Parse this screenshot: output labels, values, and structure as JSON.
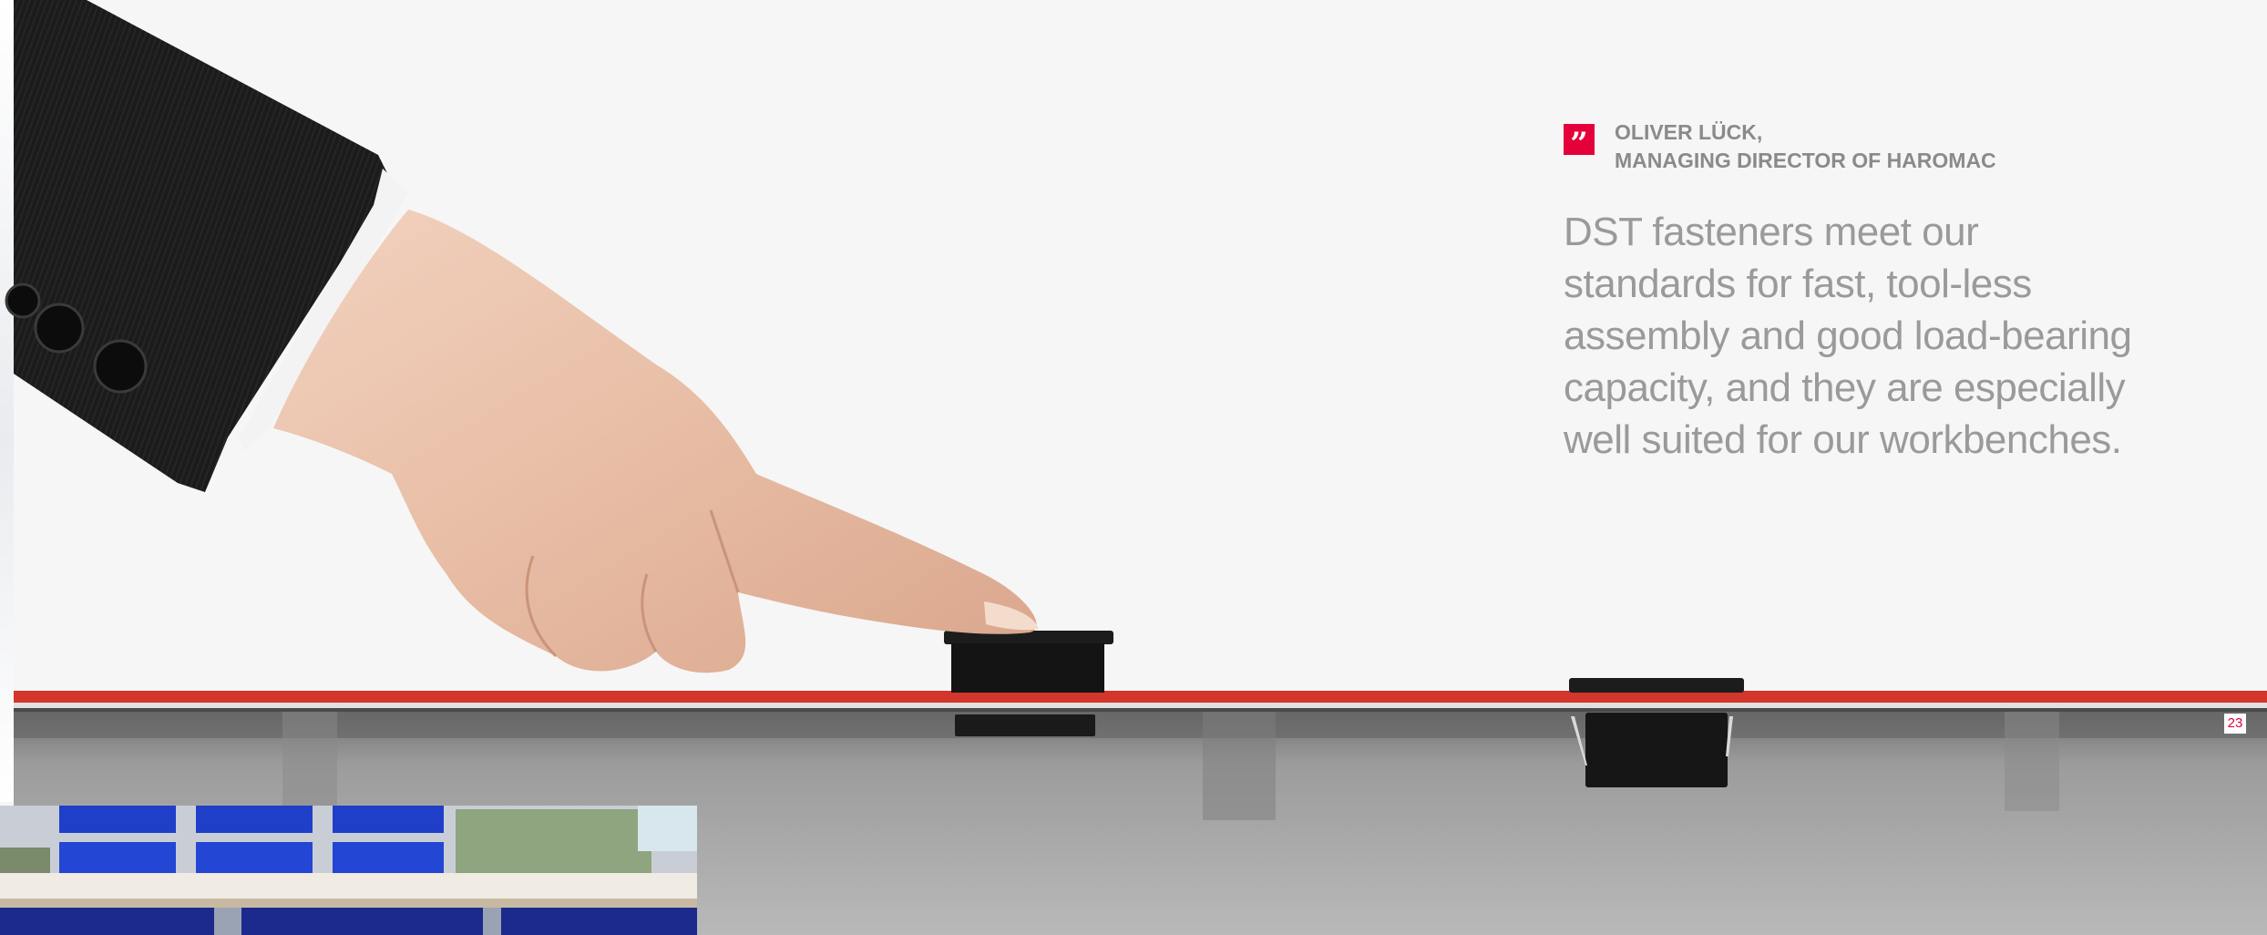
{
  "quote": {
    "icon": "quote-mark-icon",
    "mark_glyph": "”",
    "name": "OLIVER LÜCK,",
    "role": "MANAGING DIRECTOR OF HAROMAC",
    "text": "DST fasteners meet our standards for fast, tool-less assembly and good load-bearing capacity, and they are especially well suited for our workbenches."
  },
  "page_number": "23",
  "colors": {
    "accent": "#e4003a",
    "text_gray": "#9a9a9a",
    "heading_gray": "#8a8a8a",
    "tabletop_red": "#d3362b"
  }
}
